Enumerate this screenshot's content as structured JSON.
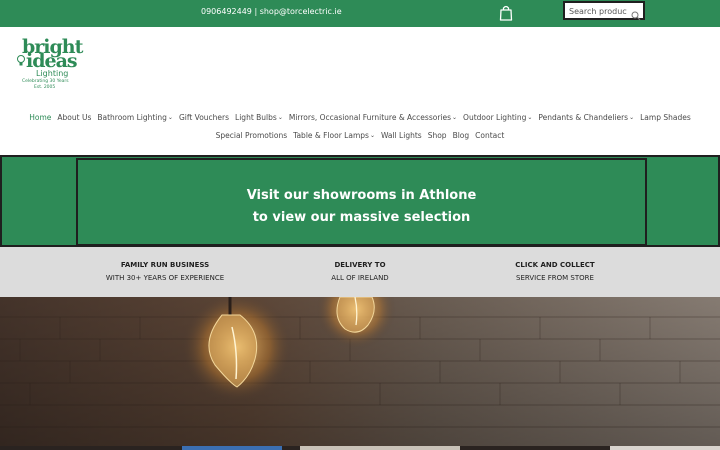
{
  "topbar": {
    "phone": "0906492449",
    "separator": " | ",
    "email": "shop@torcelectric.ie",
    "cart_icon": "shopping-bag-icon",
    "search_placeholder": "Search products",
    "search_icon": "search-icon"
  },
  "logo": {
    "line1": "bright",
    "line2": "ideas",
    "line3": "Lighting",
    "line4": "Celebrating 30 Years",
    "line5": "Est. 2005"
  },
  "nav": {
    "row1": [
      {
        "label": "Home",
        "dropdown": false,
        "active": true
      },
      {
        "label": "About Us",
        "dropdown": false
      },
      {
        "label": "Bathroom Lighting",
        "dropdown": true
      },
      {
        "label": "Gift Vouchers",
        "dropdown": false
      },
      {
        "label": "Light Bulbs",
        "dropdown": true
      },
      {
        "label": "Mirrors, Occasional Furniture & Accessories",
        "dropdown": true
      },
      {
        "label": "Outdoor Lighting",
        "dropdown": true
      },
      {
        "label": "Pendants & Chandeliers",
        "dropdown": true
      },
      {
        "label": "Lamp Shades",
        "dropdown": false
      }
    ],
    "row2": [
      {
        "label": "Special Promotions",
        "dropdown": false
      },
      {
        "label": "Table & Floor Lamps",
        "dropdown": true
      },
      {
        "label": "Wall Lights",
        "dropdown": false
      },
      {
        "label": "Shop",
        "dropdown": false
      },
      {
        "label": "Blog",
        "dropdown": false
      },
      {
        "label": "Contact",
        "dropdown": false
      }
    ],
    "chevron": "⌄"
  },
  "banner": {
    "line1": "Visit our showrooms in Athlone",
    "line2": "to view our massive selection"
  },
  "features": [
    {
      "title": "FAMILY RUN BUSINESS",
      "subtitle": "WITH 30+ YEARS OF EXPERIENCE"
    },
    {
      "title": "DELIVERY TO",
      "subtitle": "ALL OF IRELAND"
    },
    {
      "title": "CLICK AND COLLECT",
      "subtitle": "SERVICE FROM STORE"
    }
  ],
  "colors": {
    "brand_green": "#2e8b57",
    "dark_border": "#1f1f1f",
    "feature_bg": "#dcdcdc"
  }
}
